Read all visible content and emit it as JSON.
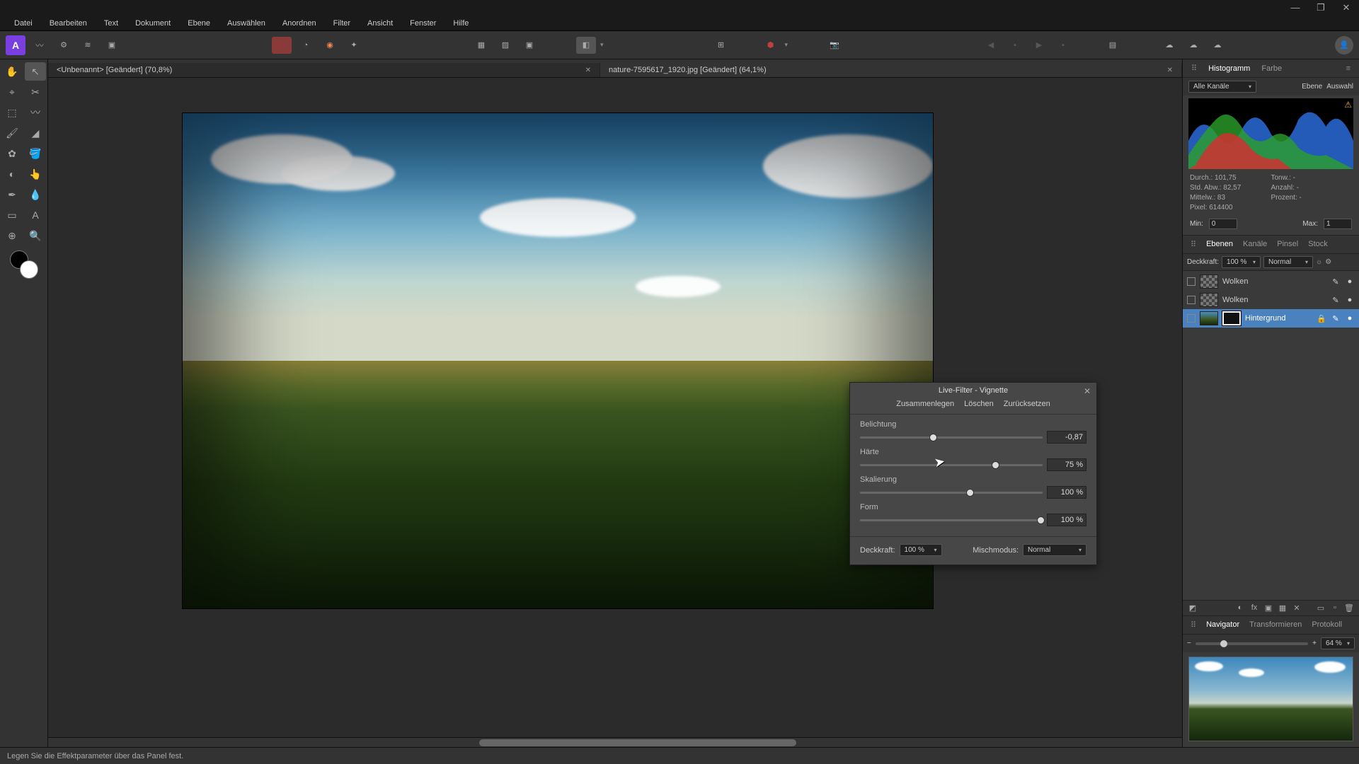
{
  "menubar": [
    "Datei",
    "Bearbeiten",
    "Text",
    "Dokument",
    "Ebene",
    "Auswählen",
    "Anordnen",
    "Filter",
    "Ansicht",
    "Fenster",
    "Hilfe"
  ],
  "doc_tabs": [
    {
      "label": "<Unbenannt> [Geändert] (70,8%)",
      "active": true
    },
    {
      "label": "nature-7595617_1920.jpg [Geändert] (64,1%)",
      "active": false
    }
  ],
  "histogram_panel": {
    "tabs": [
      "Histogramm",
      "Farbe"
    ],
    "channel_dropdown": "Alle Kanäle",
    "right_labels": [
      "Ebene",
      "Auswahl"
    ],
    "stats": {
      "durch": "Durch.: 101,75",
      "std": "Std. Abw.: 82,57",
      "mittelw": "Mittelw.: 83",
      "pixel": "Pixel: 614400",
      "tonw": "Tonw.: -",
      "anzahl": "Anzahl: -",
      "proz": "Prozent: -"
    },
    "min_label": "Min:",
    "min_val": "0",
    "max_label": "Max:",
    "max_val": "1"
  },
  "layers_panel": {
    "tabs": [
      "Ebenen",
      "Kanäle",
      "Pinsel",
      "Stock"
    ],
    "opacity_label": "Deckkraft:",
    "opacity_value": "100 %",
    "blend_mode": "Normal",
    "layers": [
      {
        "name": "Wolken",
        "selected": false,
        "thumb": "trans"
      },
      {
        "name": "Wolken",
        "selected": false,
        "thumb": "trans"
      },
      {
        "name": "Hintergrund",
        "selected": true,
        "thumb": "photo",
        "mask": true,
        "lock": true
      }
    ]
  },
  "navigator_panel": {
    "tabs": [
      "Navigator",
      "Transformieren",
      "Protokoll"
    ],
    "zoom": "64 %"
  },
  "dialog": {
    "title": "Live-Filter - Vignette",
    "actions": [
      "Zusammenlegen",
      "Löschen",
      "Zurücksetzen"
    ],
    "sliders": [
      {
        "label": "Belichtung",
        "value": "-0,87",
        "pos": 38
      },
      {
        "label": "Härte",
        "value": "75 %",
        "pos": 72
      },
      {
        "label": "Skalierung",
        "value": "100 %",
        "pos": 58
      },
      {
        "label": "Form",
        "value": "100 %",
        "pos": 97
      }
    ],
    "opacity_label": "Deckkraft:",
    "opacity_value": "100 %",
    "blend_label": "Mischmodus:",
    "blend_value": "Normal"
  },
  "statusbar": "Legen Sie die Effektparameter über das Panel fest."
}
